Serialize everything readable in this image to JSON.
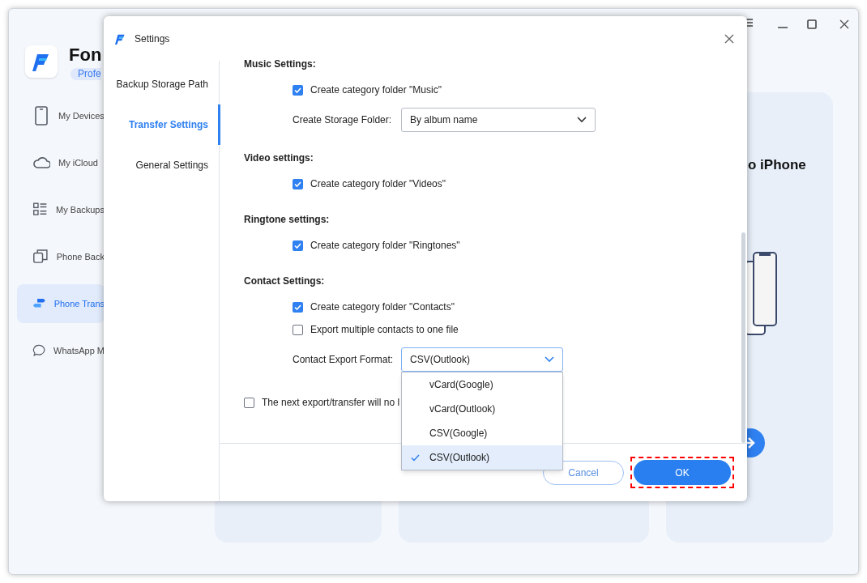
{
  "app": {
    "name": "Fon",
    "edition": "Profe",
    "nav": [
      {
        "label": "My Devices",
        "selected": false
      },
      {
        "label": "My iCloud",
        "selected": false
      },
      {
        "label": "My Backups",
        "selected": false
      },
      {
        "label": "Phone Back",
        "selected": false
      },
      {
        "label": "Phone Trans",
        "selected": true
      },
      {
        "label": "WhatsApp M",
        "selected": false
      }
    ],
    "card_title": "o iPhone"
  },
  "dialog": {
    "title": "Settings",
    "nav": [
      {
        "label": "Backup Storage Path",
        "selected": false
      },
      {
        "label": "Transfer Settings",
        "selected": true
      },
      {
        "label": "General Settings",
        "selected": false
      }
    ],
    "sections": [
      {
        "heading": "Music Settings:",
        "rows": [
          {
            "kind": "checkbox",
            "label": "Create category folder \"Music\"",
            "checked": true
          },
          {
            "kind": "select",
            "label": "Create Storage Folder:",
            "value": "By album name",
            "expanded": false
          }
        ]
      },
      {
        "heading": "Video settings:",
        "rows": [
          {
            "kind": "checkbox",
            "label": "Create category folder \"Videos\"",
            "checked": true
          }
        ]
      },
      {
        "heading": "Ringtone settings:",
        "rows": [
          {
            "kind": "checkbox",
            "label": "Create category folder \"Ringtones\"",
            "checked": true
          }
        ]
      },
      {
        "heading": "Contact Settings:",
        "rows": [
          {
            "kind": "checkbox",
            "label": "Create category folder \"Contacts\"",
            "checked": true
          },
          {
            "kind": "checkbox",
            "label": "Export multiple contacts to one file",
            "checked": false
          },
          {
            "kind": "select",
            "label": "Contact Export Format:",
            "value": "CSV(Outlook)",
            "expanded": true,
            "options": [
              {
                "label": "vCard(Google)",
                "selected": false
              },
              {
                "label": "vCard(Outlook)",
                "selected": false
              },
              {
                "label": "CSV(Google)",
                "selected": false
              },
              {
                "label": "CSV(Outlook)",
                "selected": true
              }
            ]
          }
        ]
      }
    ],
    "footer_checkbox": {
      "label": "The next export/transfer will no l",
      "checked": false
    },
    "buttons": {
      "cancel": "Cancel",
      "ok": "OK"
    }
  }
}
